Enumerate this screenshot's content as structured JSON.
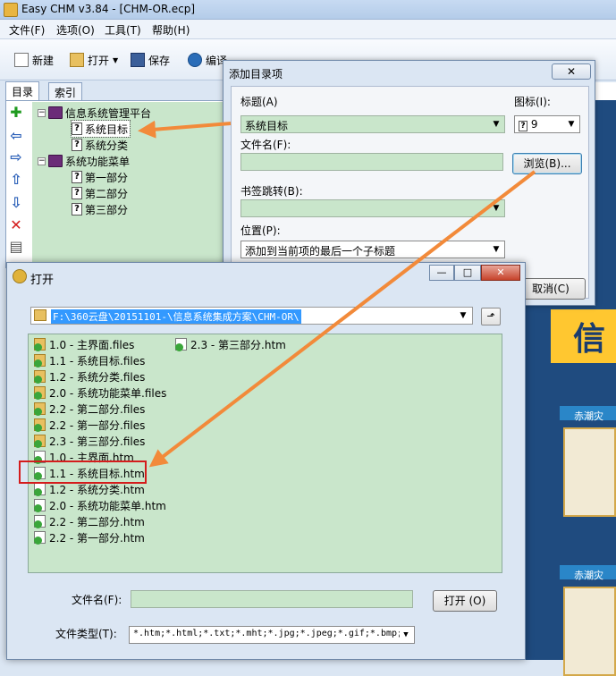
{
  "main_window": {
    "title": "Easy CHM v3.84 - [CHM-OR.ecp]",
    "menu": [
      "文件(F)",
      "选项(O)",
      "工具(T)",
      "帮助(H)"
    ],
    "toolbar": {
      "new_label": "新建",
      "open_label": "打开",
      "save_label": "保存",
      "compile_label": "编译"
    },
    "tabs": [
      "目录",
      "索引"
    ],
    "tree": {
      "root1": "信息系统管理平台",
      "root1_children": [
        "系统目标",
        "系统分类"
      ],
      "root2": "系统功能菜单",
      "root2_children": [
        "第一部分",
        "第二部分",
        "第三部分"
      ]
    },
    "background_text": {
      "big_char": "信",
      "card1": "赤潮灾",
      "card2": "赤潮灾"
    }
  },
  "toc_dialog": {
    "title": "添加目录项",
    "close_glyph": "✕",
    "title_label": "标题(A)",
    "title_value": "系统目标",
    "icon_label": "图标(I):",
    "icon_value": "9",
    "filename_label": "文件名(F):",
    "filename_value": "",
    "browse_label": "浏览(B)...",
    "bookmark_label": "书签跳转(B):",
    "bookmark_value": "",
    "position_label": "位置(P):",
    "position_value": "添加到当前项的最后一个子标题",
    "cancel_label": "取消(C)"
  },
  "open_dialog": {
    "title": "打开",
    "close_glyph": "✕",
    "min_glyph": "—",
    "max_glyph": "□",
    "path": "F:\\360云盘\\20151101-\\信息系统集成方案\\CHM-OR\\",
    "up_glyph": "⬏",
    "files_col1": [
      "1.0 - 主界面.files",
      "1.1 - 系统目标.files",
      "1.2 - 系统分类.files",
      "2.0 - 系统功能菜单.files",
      "2.2 - 第二部分.files",
      "2.2 - 第一部分.files",
      "2.3 - 第三部分.files",
      "1.0 - 主界面.htm",
      "1.1 - 系统目标.htm",
      "1.2 - 系统分类.htm",
      "2.0 - 系统功能菜单.htm",
      "2.2 - 第二部分.htm",
      "2.2 - 第一部分.htm"
    ],
    "files_col2": [
      "2.3 - 第三部分.htm"
    ],
    "filename_label": "文件名(F):",
    "filename_value": "",
    "open_label": "打开 (O)",
    "filetype_label": "文件类型(T):",
    "filetype_value": "*.htm;*.html;*.txt;*.mht;*.jpg;*.jpeg;*.gif;*.bmp;"
  },
  "colors": {
    "field_green": "#c9e6cb",
    "arrow_orange": "#f28a3a",
    "highlight_red": "#d41c1c"
  }
}
